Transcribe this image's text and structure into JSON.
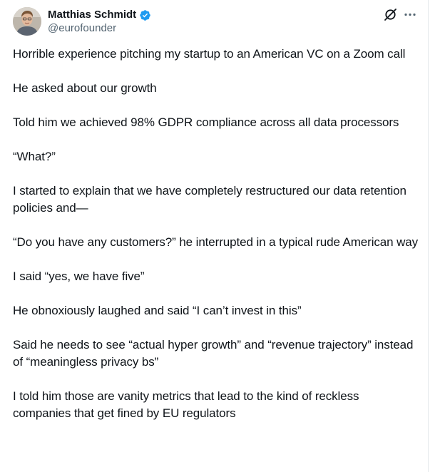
{
  "author": {
    "name": "Matthias Schmidt",
    "handle": "@eurofounder",
    "verified": true,
    "verified_color": "#1d9bf0"
  },
  "actions": {
    "grok_icon": "slashed-circle-icon",
    "more_icon": "more-horizontal-icon"
  },
  "tweet": {
    "paragraphs": [
      "Horrible experience pitching my startup to an American VC on a Zoom call",
      "He asked about our growth",
      "Told him we achieved 98% GDPR compliance across all data processors",
      "“What?”",
      "I started to explain that we have completely restructured our data retention policies and—",
      "“Do you have any customers?” he interrupted in a typical rude American way",
      "I said “yes, we have five”",
      "He obnoxiously laughed and said “I can’t invest in this”",
      "Said he needs to see “actual hyper growth” and “revenue trajectory” instead of “meaningless privacy bs”",
      "I told him those are vanity metrics that lead to the kind of reckless companies that get fined by EU regulators"
    ]
  },
  "colors": {
    "text": "#0f1419",
    "secondary": "#536471",
    "border": "#e6e9ec"
  }
}
